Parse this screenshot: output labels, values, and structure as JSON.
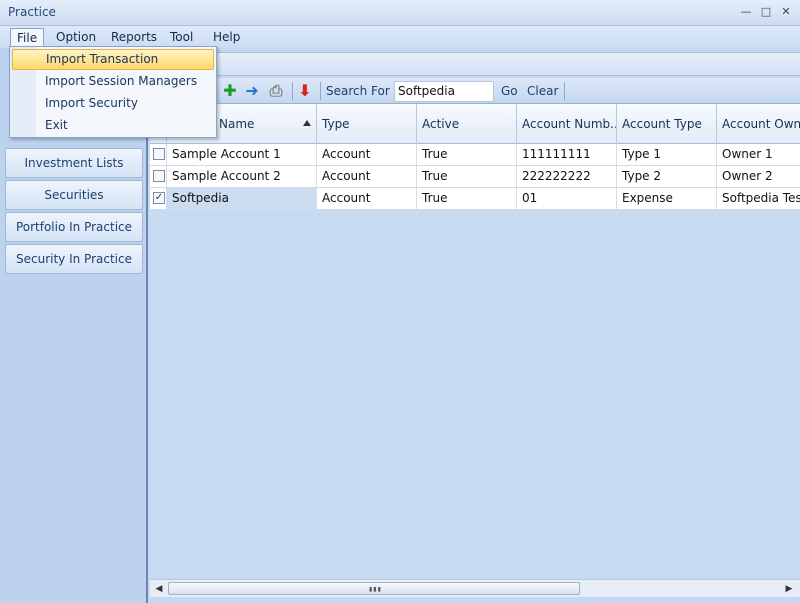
{
  "window": {
    "title": "Practice"
  },
  "menubar": {
    "items": [
      "File",
      "Option",
      "Reports",
      "Tool",
      "Help"
    ]
  },
  "file_menu": {
    "items": [
      "Import Transaction",
      "Import Session Managers",
      "Import Security",
      "Exit"
    ]
  },
  "left_nav": {
    "items": [
      "Investment Lists",
      "Securities",
      "Portfolio In Practice",
      "Security In Practice"
    ]
  },
  "toolbar": {
    "search_label": "Search For",
    "search_value": "Softpedia",
    "go_label": "Go",
    "clear_label": "Clear"
  },
  "grid": {
    "columns": [
      "Name",
      "Type",
      "Active",
      "Account Numb...",
      "Account Type",
      "Account Owne"
    ],
    "rows": [
      {
        "checked": false,
        "cells": [
          "Sample Account 1",
          "Account",
          "True",
          "111111111",
          "Type 1",
          "Owner 1"
        ]
      },
      {
        "checked": false,
        "cells": [
          "Sample Account 2",
          "Account",
          "True",
          "222222222",
          "Type 2",
          "Owner 2"
        ]
      },
      {
        "checked": true,
        "cells": [
          "Softpedia",
          "Account",
          "True",
          "01",
          "Expense",
          "Softpedia Test"
        ]
      }
    ]
  },
  "colors": {
    "accent": "#ffd86a",
    "nav_bg": "#bcd2ee",
    "grid_bg": "#c6daf2"
  },
  "icons": [
    "minimize-icon",
    "maximize-icon",
    "close-icon",
    "add-icon",
    "forward-arrow-icon",
    "print-icon",
    "delete-arrow-icon",
    "sort-ascending-icon",
    "checkbox-icon"
  ]
}
